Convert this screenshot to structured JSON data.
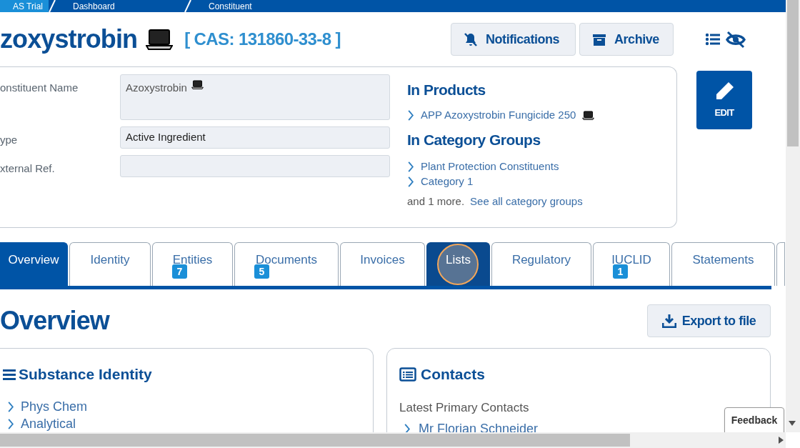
{
  "breadcrumbs": [
    "AS Trial",
    "Dashboard",
    "Constituent"
  ],
  "title": "zoxystrobin",
  "cas": "[ CAS: 131860-33-8 ]",
  "actions": [
    "Notifications",
    "Archive"
  ],
  "fields": [
    {
      "label": "onstituent Name",
      "value": "Azoxystrobin",
      "kind": "textarea"
    },
    {
      "label": "ype",
      "value": "Active Ingredient",
      "kind": "input"
    },
    {
      "label": "xternal Ref.",
      "kind": "input"
    }
  ],
  "in_products": {
    "heading": "In Products",
    "items": [
      "APP Azoxystrobin Fungicide 250"
    ]
  },
  "in_category_groups": {
    "heading": "In Category Groups",
    "items": [
      "Plant Protection Constituents",
      "Category 1"
    ],
    "more": "and 1 more.",
    "more_link": "See all category groups"
  },
  "edit_button": "EDIT",
  "tabs": [
    {
      "label": "Overview",
      "selected": true,
      "highlighted": false
    },
    {
      "label": "Identity",
      "selected": false,
      "highlighted": false
    },
    {
      "label": "Entities",
      "badge": "7",
      "selected": false,
      "highlighted": false
    },
    {
      "label": "Documents",
      "badge": "5",
      "selected": false,
      "highlighted": false
    },
    {
      "label": "Invoices",
      "selected": false,
      "highlighted": false
    },
    {
      "label": "Lists",
      "selected": false,
      "highlighted": true
    },
    {
      "label": "Regulatory",
      "selected": false,
      "highlighted": false
    },
    {
      "label": "IUCLID",
      "badge": "1",
      "selected": false,
      "highlighted": false
    },
    {
      "label": "Statements",
      "selected": false,
      "highlighted": false
    }
  ],
  "section_title": "Overview",
  "export_button": "Export to file",
  "substance_identity": {
    "heading": "Substance Identity",
    "items": [
      "Phys Chem",
      "Analytical"
    ]
  },
  "contacts": {
    "heading": "Contacts",
    "subheading": "Latest Primary Contacts",
    "items": [
      "Mr Florian Schneider"
    ]
  },
  "feedback": "Feedback"
}
